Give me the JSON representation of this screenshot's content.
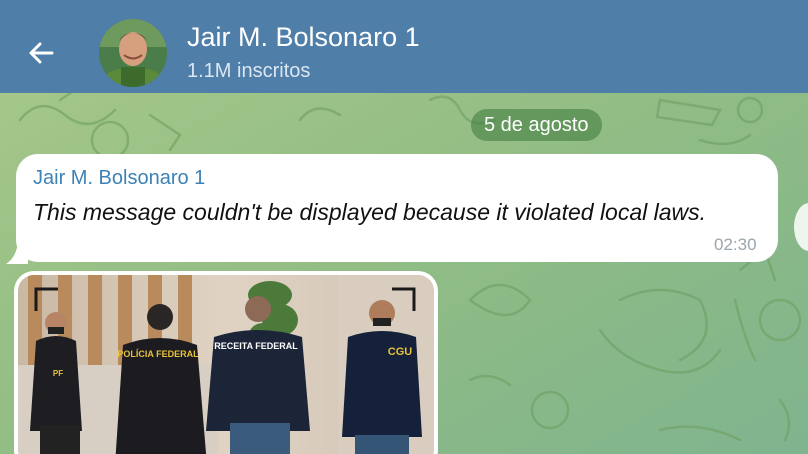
{
  "header": {
    "channel_name": "Jair M. Bolsonaro 1",
    "subscribers": "1.1M inscritos"
  },
  "chat": {
    "date_separator": "5 de agosto",
    "message": {
      "sender": "Jair M. Bolsonaro 1",
      "text": "This message couldn't be displayed because it violated local laws.",
      "time": "02:30"
    },
    "photo": {
      "labels": {
        "agent1_badge": "PF",
        "agent2_jacket": "POLÍCIA FEDERAL",
        "agent3_jacket": "RECEITA FEDERAL",
        "agent4_jacket": "CGU"
      }
    }
  },
  "icons": {
    "back": "arrow-left-icon"
  },
  "colors": {
    "header": "#4f7ea9",
    "chat_background": "#94bd83",
    "sender_name": "#3d82b6",
    "date_pill": "#5f9a57"
  }
}
